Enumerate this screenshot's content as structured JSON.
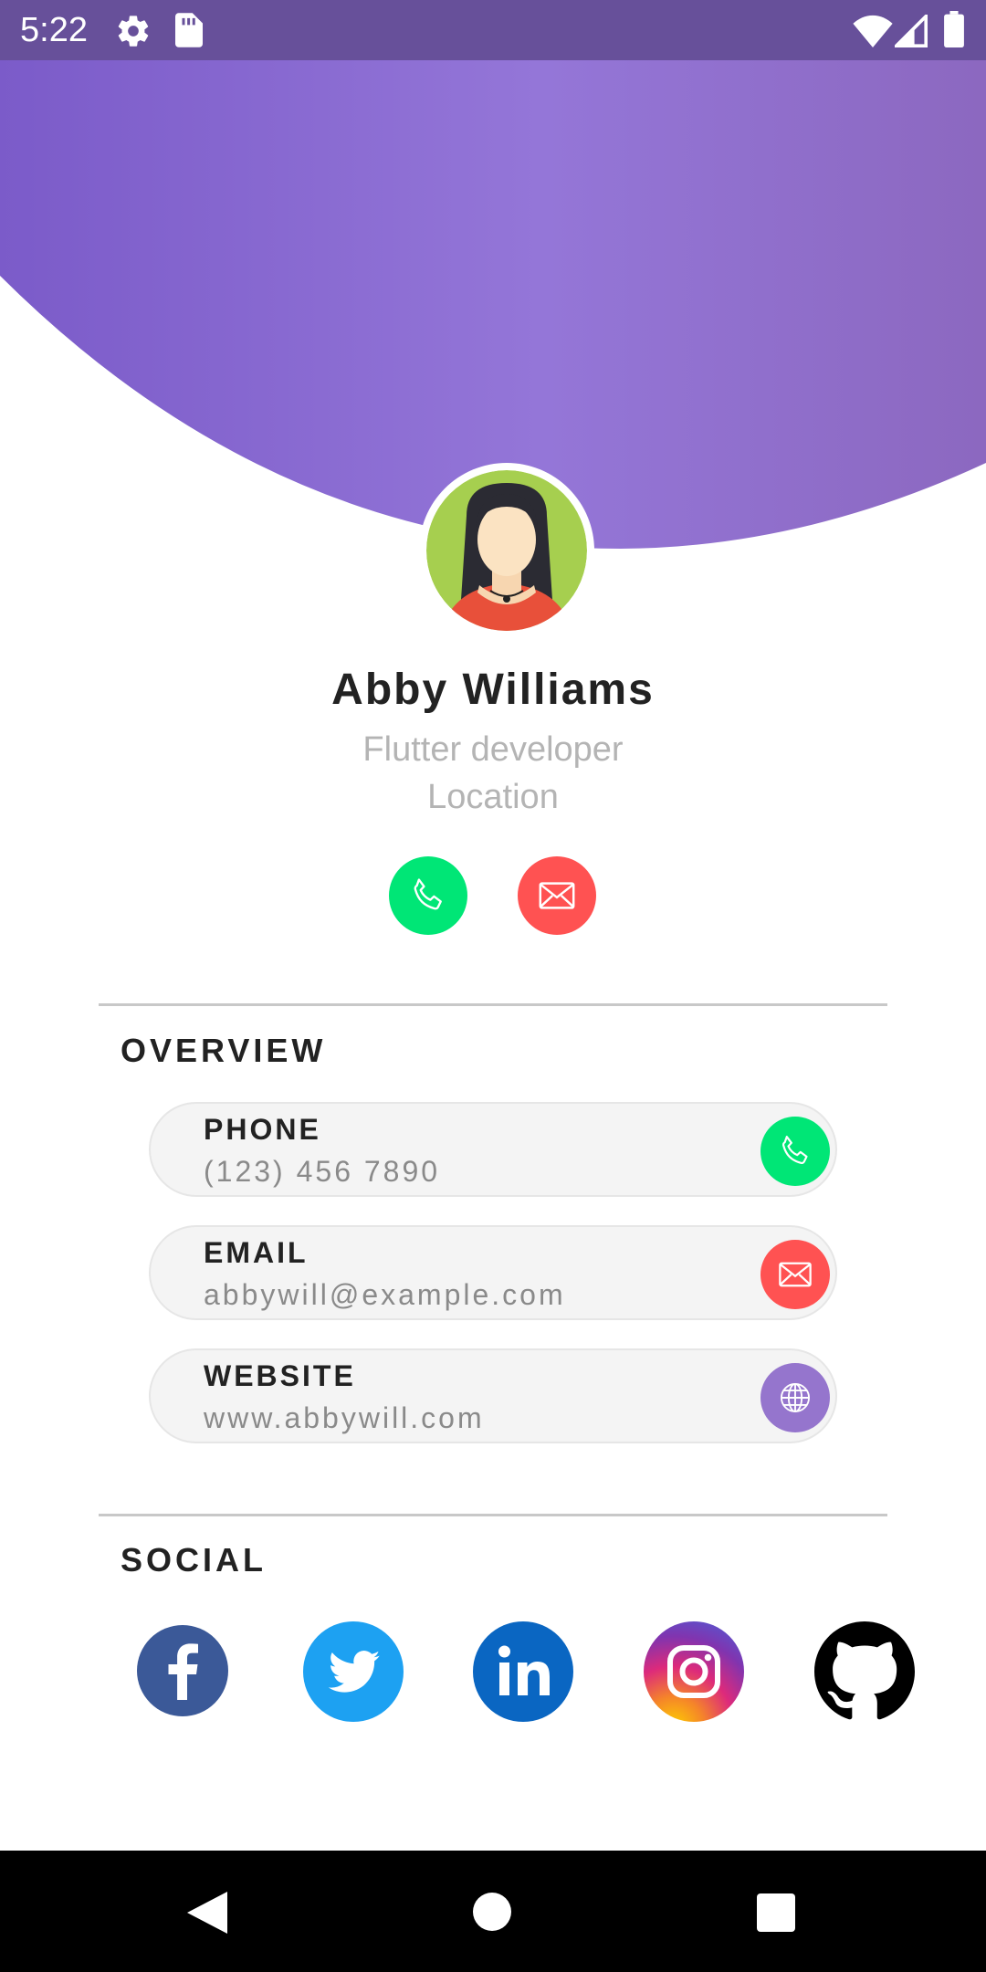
{
  "status_bar": {
    "time": "5:22",
    "icons": [
      "gear-icon",
      "sd-card-icon",
      "wifi-icon",
      "cell-signal-icon",
      "battery-icon"
    ],
    "background": "#67509a"
  },
  "header": {
    "gradient_colors": [
      "#7b5bc9",
      "#9476d8",
      "#8c68c0"
    ]
  },
  "profile": {
    "name": "Abby Williams",
    "role": "Flutter developer",
    "location": "Location",
    "avatar_icon": "female-avatar-icon"
  },
  "actions": [
    {
      "icon": "phone-icon",
      "color": "#00e676"
    },
    {
      "icon": "mail-icon",
      "color": "#ff5252"
    }
  ],
  "overview": {
    "title": "OVERVIEW",
    "items": [
      {
        "label": "PHONE",
        "value": "(123) 456 7890",
        "icon": "phone-icon",
        "color": "#00e676"
      },
      {
        "label": "EMAIL",
        "value": "abbywill@example.com",
        "icon": "mail-icon",
        "color": "#ff5252"
      },
      {
        "label": "WEBSITE",
        "value": "www.abbywill.com",
        "icon": "globe-icon",
        "color": "#9575cd"
      }
    ]
  },
  "social": {
    "title": "SOCIAL",
    "items": [
      {
        "icon": "facebook-icon",
        "color": "#3b5998"
      },
      {
        "icon": "twitter-icon",
        "color": "#1da1f2"
      },
      {
        "icon": "linkedin-icon",
        "color": "#0a66c2"
      },
      {
        "icon": "instagram-icon",
        "color": "#e1306c"
      },
      {
        "icon": "github-icon",
        "color": "#000000"
      }
    ]
  },
  "nav_bar": {
    "buttons": [
      "back-icon",
      "home-icon",
      "recents-icon"
    ]
  }
}
